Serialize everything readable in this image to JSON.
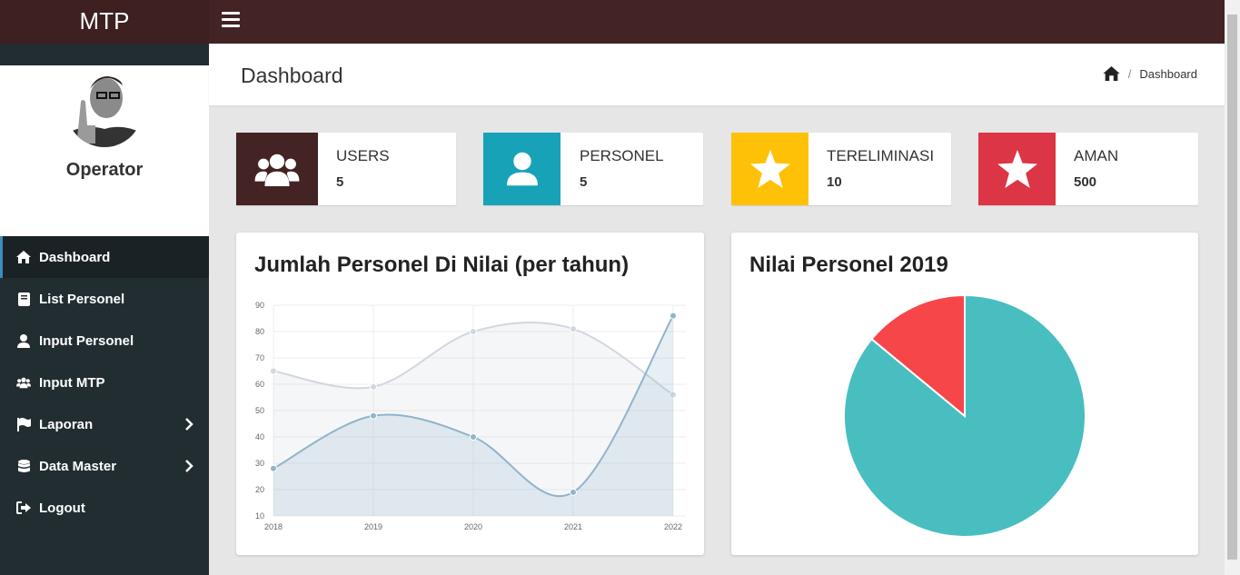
{
  "brand": "MTP",
  "user": {
    "name": "Operator"
  },
  "sidebar": {
    "items": [
      {
        "label": "Dashboard",
        "icon": "home-icon"
      },
      {
        "label": "List Personel",
        "icon": "book-icon"
      },
      {
        "label": "Input Personel",
        "icon": "user-icon"
      },
      {
        "label": "Input MTP",
        "icon": "users-icon"
      },
      {
        "label": "Laporan",
        "icon": "flag-icon"
      },
      {
        "label": "Data Master",
        "icon": "database-icon"
      },
      {
        "label": "Logout",
        "icon": "sign-out-icon"
      }
    ]
  },
  "header": {
    "title": "Dashboard",
    "breadcrumb": "Dashboard",
    "breadcrumb_sep": "/"
  },
  "info_boxes": [
    {
      "label": "USERS",
      "value": "5",
      "color": "#432323",
      "icon": "users-icon"
    },
    {
      "label": "PERSONEL",
      "value": "5",
      "color": "#17a2b8",
      "icon": "user-icon"
    },
    {
      "label": "TERELIMINASI",
      "value": "10",
      "color": "#ffc107",
      "icon": "star-icon"
    },
    {
      "label": "AMAN",
      "value": "500",
      "color": "#dc3545",
      "icon": "star-icon"
    }
  ],
  "charts": {
    "line_title": "Jumlah Personel Di Nilai (per tahun)",
    "pie_title": "Nilai Personel 2019"
  },
  "chart_data": [
    {
      "type": "area",
      "title": "Jumlah Personel Di Nilai (per tahun)",
      "categories": [
        "2018",
        "2019",
        "2020",
        "2021",
        "2022"
      ],
      "series": [
        {
          "values": [
            65,
            59,
            80,
            81,
            56
          ],
          "color": "#d2d6de"
        },
        {
          "values": [
            28,
            48,
            40,
            19,
            86
          ],
          "color": "#8fb4cb"
        }
      ],
      "ylim": [
        10,
        90
      ],
      "yticks": [
        10,
        20,
        30,
        40,
        50,
        60,
        70,
        80,
        90
      ],
      "grid": true
    },
    {
      "type": "pie",
      "title": "Nilai Personel 2019",
      "values": [
        86,
        14
      ],
      "colors": [
        "#48bec0",
        "#f7464a"
      ]
    }
  ]
}
